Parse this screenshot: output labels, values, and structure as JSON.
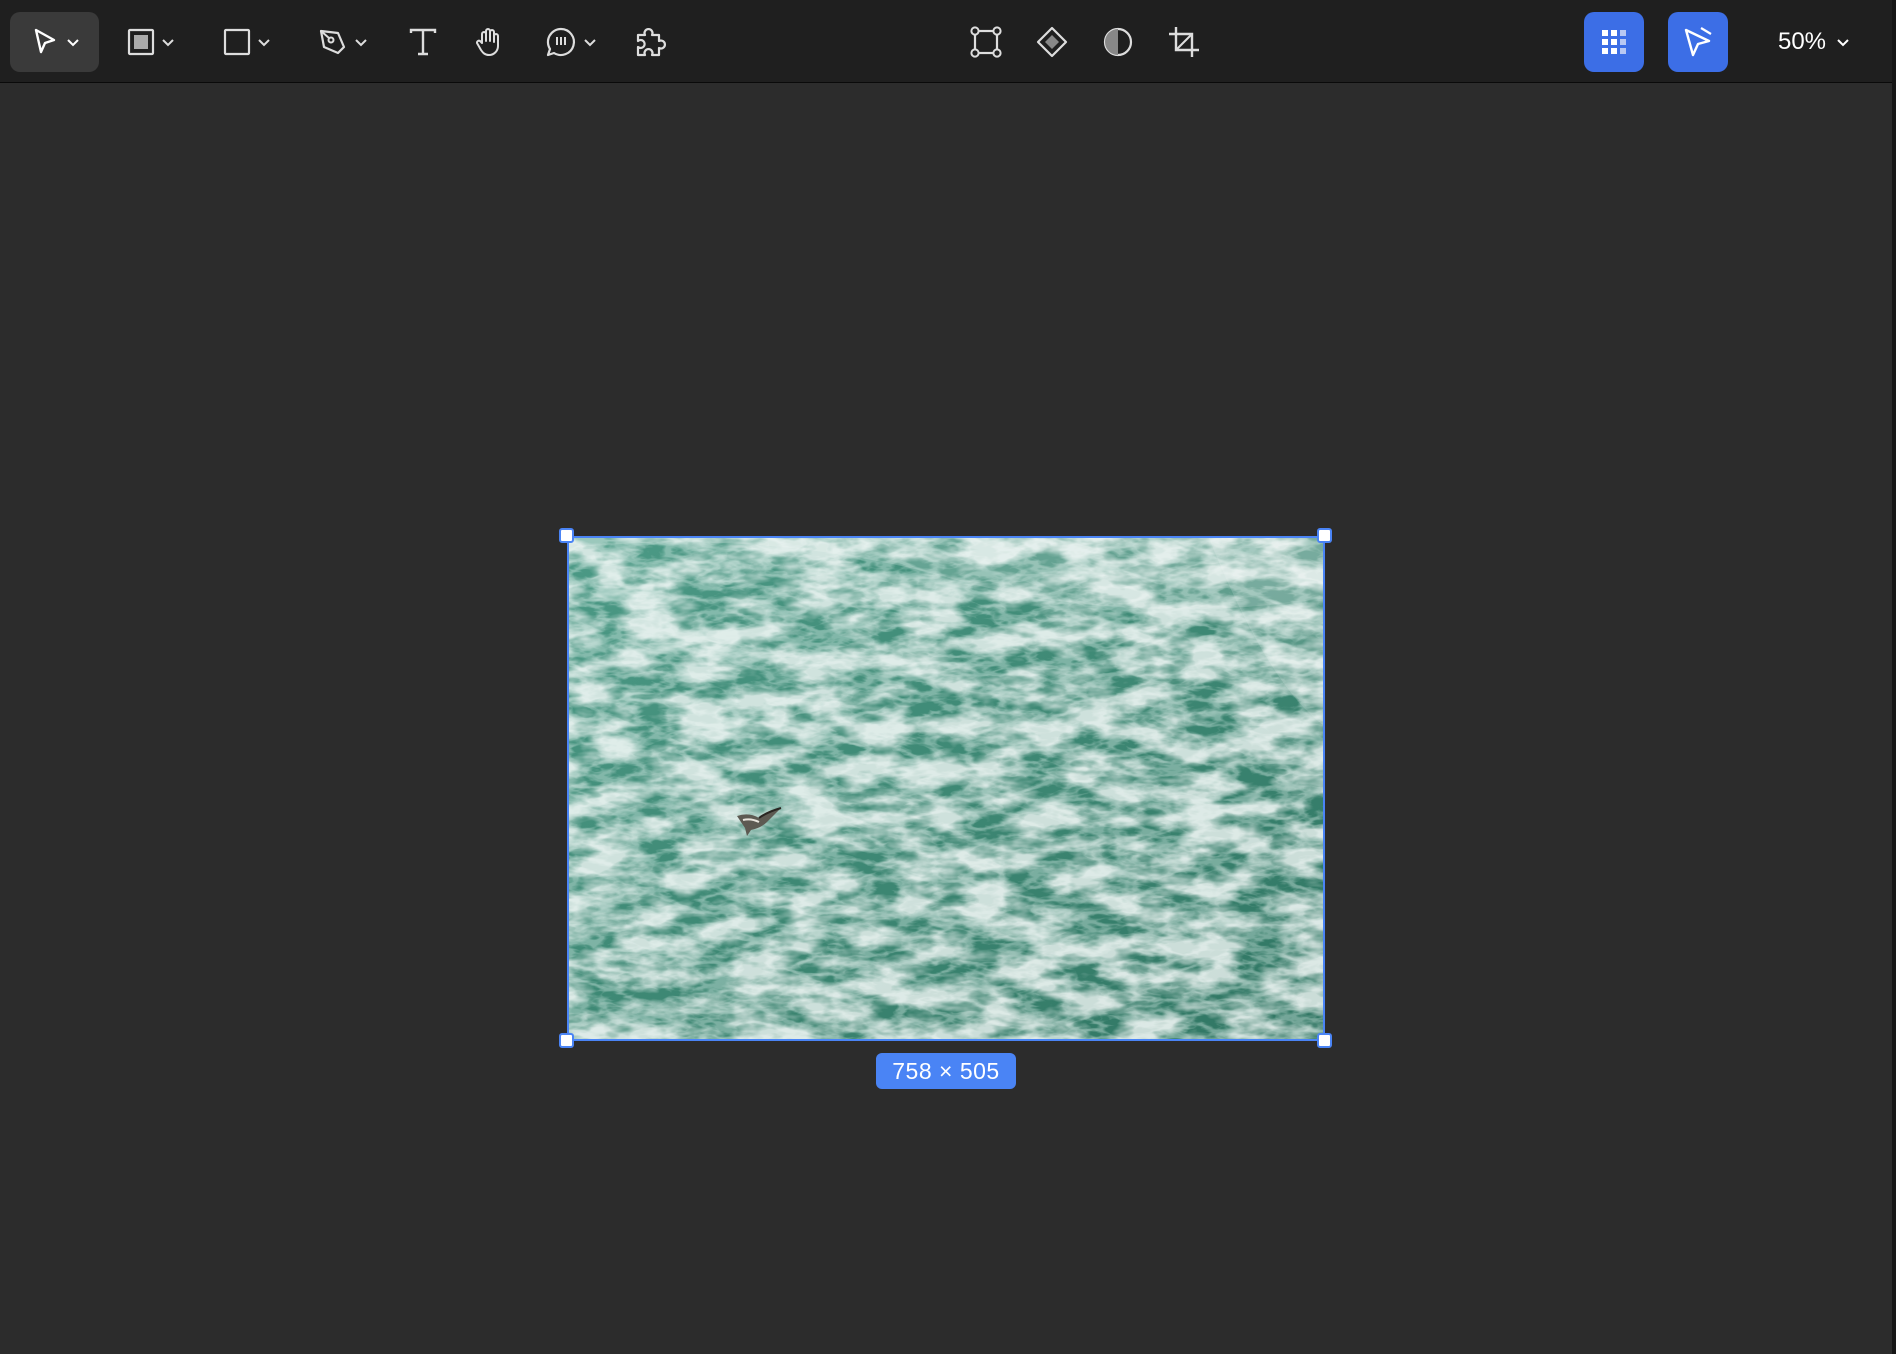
{
  "toolbar": {
    "tools_left": [
      {
        "name": "move-tool",
        "icon": "pointer-icon",
        "has_menu": true
      },
      {
        "name": "frame-tool",
        "icon": "frame-icon",
        "has_menu": true
      },
      {
        "name": "shape-tool",
        "icon": "rectangle-icon",
        "has_menu": true
      },
      {
        "name": "pen-tool",
        "icon": "pen-icon",
        "has_menu": true
      },
      {
        "name": "text-tool",
        "icon": "text-icon",
        "has_menu": false
      },
      {
        "name": "hand-tool",
        "icon": "hand-icon",
        "has_menu": false
      },
      {
        "name": "comment-tool",
        "icon": "comment-icon",
        "has_menu": true
      },
      {
        "name": "plugins-tool",
        "icon": "puzzle-icon",
        "has_menu": false
      }
    ],
    "tools_center": [
      {
        "name": "edit-object",
        "icon": "vector-edit-icon"
      },
      {
        "name": "create-component",
        "icon": "component-icon"
      },
      {
        "name": "mask",
        "icon": "contrast-icon"
      },
      {
        "name": "crop",
        "icon": "crop-icon"
      }
    ],
    "right_buttons": [
      {
        "name": "resources",
        "icon": "grid-icon"
      },
      {
        "name": "present",
        "icon": "pointer-play-icon"
      }
    ],
    "zoom": "50%",
    "accent_color": "#3c6ee6"
  },
  "canvas": {
    "background": "#2c2c2c",
    "selection": {
      "size_label": "758 × 505",
      "color": "#4a84f5"
    }
  }
}
